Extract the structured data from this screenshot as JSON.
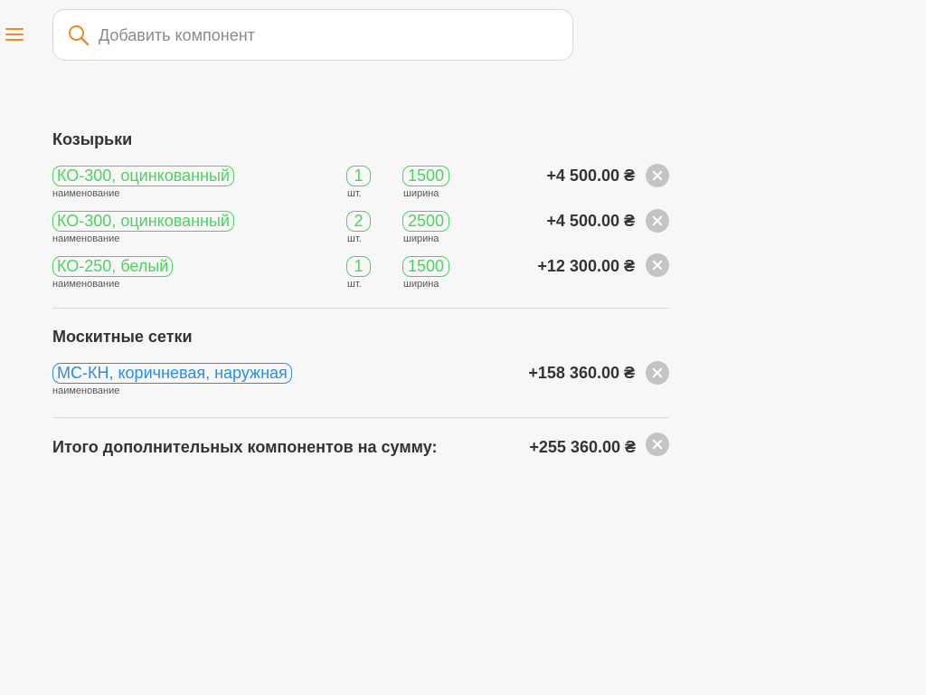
{
  "search": {
    "placeholder": "Добавить компонент"
  },
  "sections": [
    {
      "title": "Козырьки",
      "items": [
        {
          "name": "КО-300, оцинкованный",
          "name_label": "наименование",
          "qty": "1",
          "qty_label": "шт.",
          "width": "1500",
          "width_label": "ширина",
          "price": "+4 500.00 ₴"
        },
        {
          "name": "КО-300, оцинкованный",
          "name_label": "наименование",
          "qty": "2",
          "qty_label": "шт.",
          "width": "2500",
          "width_label": "ширина",
          "price": "+4 500.00 ₴"
        },
        {
          "name": "КО-250, белый",
          "name_label": "наименование",
          "qty": "1",
          "qty_label": "шт.",
          "width": "1500",
          "width_label": "ширина",
          "price": "+12 300.00 ₴"
        }
      ]
    },
    {
      "title": "Москитные сетки",
      "items": [
        {
          "name": "МС-КН, коричневая, наружная",
          "name_label": "наименование",
          "price": "+158 360.00 ₴"
        }
      ]
    }
  ],
  "total": {
    "label": "Итого дополнительных компонентов на сумму:",
    "price": "+255 360.00 ₴"
  },
  "colors": {
    "accent": "#f08a24",
    "chip_green": "#4cd35f",
    "chip_blue": "#2a8de8",
    "remove_gray": "#c4c4c4"
  },
  "icons": {
    "menu": "hamburger-icon",
    "search": "search-icon",
    "remove": "close-circle-icon"
  }
}
